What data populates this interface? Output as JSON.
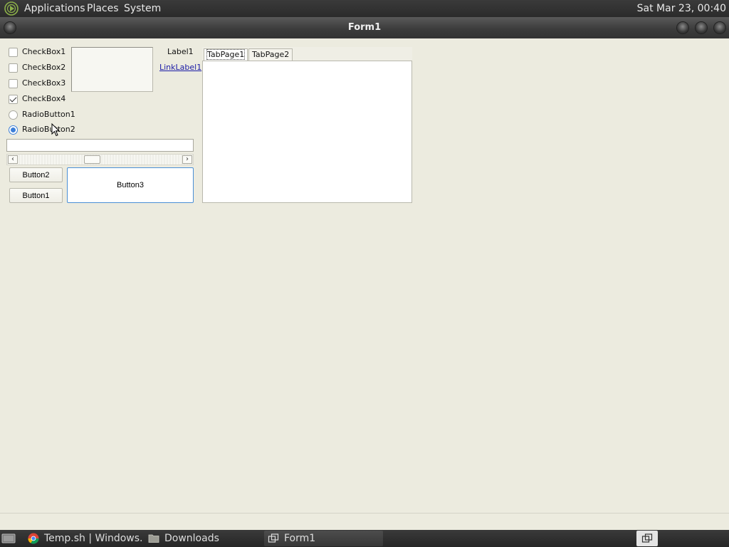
{
  "top_panel": {
    "menus": [
      "Applications",
      "Places",
      "System"
    ],
    "clock": "Sat Mar 23, 00:40"
  },
  "window": {
    "title": "Form1"
  },
  "form": {
    "checkboxes": [
      {
        "label": "CheckBox1",
        "checked": false
      },
      {
        "label": "CheckBox2",
        "checked": false
      },
      {
        "label": "CheckBox3",
        "checked": false
      },
      {
        "label": "CheckBox4",
        "checked": true
      }
    ],
    "radios": [
      {
        "label": "RadioButton1",
        "selected": false
      },
      {
        "label": "RadioButton2",
        "selected": true
      }
    ],
    "label1": "Label1",
    "linklabel1": "LinkLabel1",
    "textbox_value": "",
    "scroll_left_glyph": "‹",
    "scroll_right_glyph": "›",
    "buttons": {
      "button1": "Button1",
      "button2": "Button2",
      "button3": "Button3"
    },
    "tabs": [
      "TabPage1",
      "TabPage2"
    ],
    "active_tab": "TabPage1"
  },
  "taskbar": {
    "items": [
      {
        "label": "Temp.sh | Windows...",
        "icon": "chrome-icon",
        "active": false
      },
      {
        "label": "Downloads",
        "icon": "folder-icon",
        "active": false
      },
      {
        "label": "Form1",
        "icon": "window-icon",
        "active": true
      }
    ]
  },
  "colors": {
    "form_bg": "#ecebdf",
    "panel_bg": "#2b2b2b",
    "accent": "#3d7fd8",
    "link": "#1a1aa6"
  }
}
